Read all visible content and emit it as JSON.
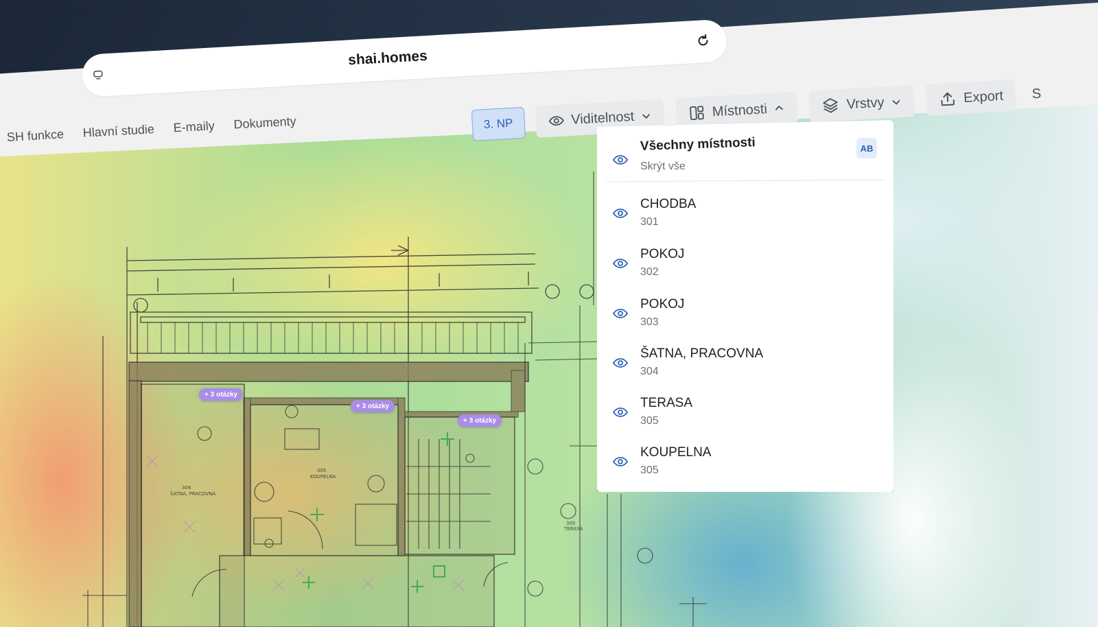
{
  "browser": {
    "url": "shai.homes"
  },
  "nav": {
    "items": [
      "SH funkce",
      "Hlavní studie",
      "E-maily",
      "Dokumenty"
    ]
  },
  "toolbar": {
    "floor_label": "3. NP",
    "visibility_label": "Viditelnost",
    "rooms_label": "Místnosti",
    "layers_label": "Vrstvy",
    "export_label": "Export",
    "partial_label": "S"
  },
  "rooms_dropdown": {
    "title": "Všechny místnosti",
    "subtitle": "Skrýt vše",
    "badge": "AB",
    "rooms": [
      {
        "name": "CHODBA",
        "number": "301"
      },
      {
        "name": "POKOJ",
        "number": "302"
      },
      {
        "name": "POKOJ",
        "number": "303"
      },
      {
        "name": "ŠATNA, PRACOVNA",
        "number": "304"
      },
      {
        "name": "TERASA",
        "number": "305"
      },
      {
        "name": "KOUPELNA",
        "number": "305"
      }
    ]
  },
  "plan": {
    "question_tags": [
      "+ 3 otázky",
      "+ 3 otázky",
      "+ 3 otázky"
    ],
    "room_labels": [
      {
        "number": "304",
        "name": "ŠATNA, PRACOVNA"
      },
      {
        "number": "305",
        "name": "KOUPELNA"
      },
      {
        "number": "305",
        "name": "TERASA"
      }
    ]
  },
  "colors": {
    "accent": "#2e5fb8",
    "floor_badge_bg": "#cfe0f7",
    "question_tag": "#a98de6",
    "chrome_bg": "#f1f1f2"
  },
  "icons": {
    "site": "site-icon",
    "reload": "reload-icon",
    "visibility": "eye-icon",
    "rooms": "layout-grid-icon",
    "layers": "layers-icon",
    "export": "upload-icon",
    "expand": "chevron-down-icon",
    "collapse": "chevron-up-icon"
  }
}
